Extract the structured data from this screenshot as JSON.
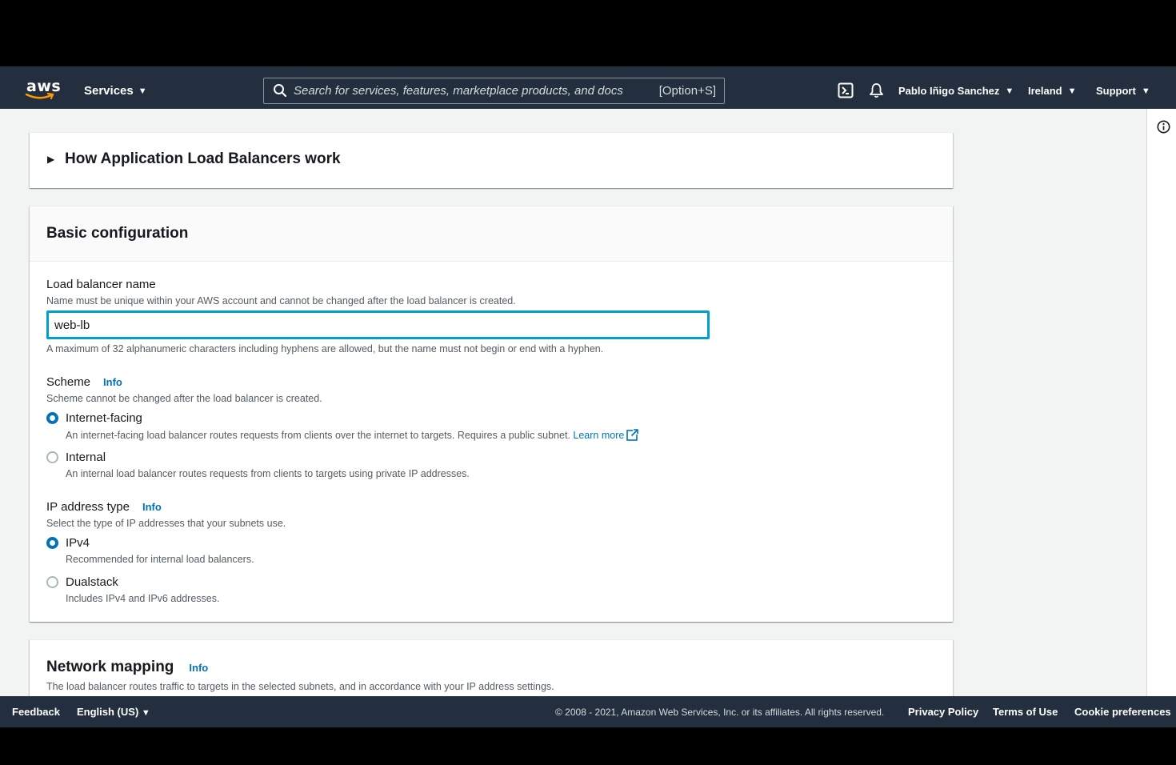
{
  "topnav": {
    "logo_text": "aws",
    "services_label": "Services",
    "search_placeholder": "Search for services, features, marketplace products, and docs",
    "search_shortcut": "[Option+S]",
    "user_label": "Pablo Iñigo Sanchez",
    "region_label": "Ireland",
    "support_label": "Support"
  },
  "how_panel": {
    "title": "How Application Load Balancers work"
  },
  "basic": {
    "title": "Basic configuration",
    "name_label": "Load balancer name",
    "name_desc": "Name must be unique within your AWS account and cannot be changed after the load balancer is created.",
    "name_value": "web-lb",
    "name_constraint": "A maximum of 32 alphanumeric characters including hyphens are allowed, but the name must not begin or end with a hyphen.",
    "scheme_label": "Scheme",
    "scheme_info": "Info",
    "scheme_desc": "Scheme cannot be changed after the load balancer is created.",
    "scheme_options": [
      {
        "label": "Internet-facing",
        "desc": "An internet-facing load balancer routes requests from clients over the internet to targets. Requires a public subnet.",
        "link": "Learn more",
        "checked": true
      },
      {
        "label": "Internal",
        "desc": "An internal load balancer routes requests from clients to targets using private IP addresses.",
        "checked": false
      }
    ],
    "ip_label": "IP address type",
    "ip_info": "Info",
    "ip_desc": "Select the type of IP addresses that your subnets use.",
    "ip_options": [
      {
        "label": "IPv4",
        "desc": "Recommended for internal load balancers.",
        "checked": true
      },
      {
        "label": "Dualstack",
        "desc": "Includes IPv4 and IPv6 addresses.",
        "checked": false
      }
    ]
  },
  "network": {
    "title": "Network mapping",
    "info": "Info",
    "desc": "The load balancer routes traffic to targets in the selected subnets, and in accordance with your IP address settings."
  },
  "footer": {
    "feedback": "Feedback",
    "language": "English (US)",
    "copyright": "© 2008 - 2021, Amazon Web Services, Inc. or its affiliates. All rights reserved.",
    "privacy": "Privacy Policy",
    "terms": "Terms of Use",
    "cookies": "Cookie preferences"
  },
  "colors": {
    "nav_bg": "#232f3e",
    "accent_blue": "#0073bb",
    "focus_border": "#00a1c9",
    "aws_orange": "#ff9900"
  }
}
